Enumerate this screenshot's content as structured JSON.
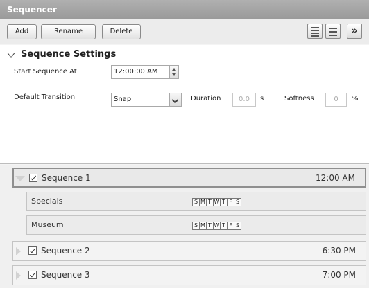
{
  "window": {
    "title": "Sequencer"
  },
  "toolbar": {
    "add_label": "Add",
    "rename_label": "Rename",
    "delete_label": "Delete",
    "icons": [
      "list-view-icon",
      "detail-view-icon",
      "expand-panel-icon"
    ],
    "more_glyph": "»"
  },
  "settings": {
    "title": "Sequence Settings",
    "start_label": "Start Sequence At",
    "start_value": "12:00:00 AM",
    "transition_label": "Default Transition",
    "transition_value": "Snap",
    "duration_label": "Duration",
    "duration_value": "0.0",
    "duration_unit": "s",
    "softness_label": "Softness",
    "softness_value": "0",
    "softness_unit": "%"
  },
  "sequences": [
    {
      "name": "Sequence 1",
      "time": "12:00 AM",
      "expanded": true,
      "children": [
        {
          "name": "Specials",
          "days": [
            "S",
            "M",
            "T",
            "W",
            "T",
            "F",
            "S"
          ]
        },
        {
          "name": "Museum",
          "days": [
            "S",
            "M",
            "T",
            "W",
            "T",
            "F",
            "S"
          ]
        }
      ]
    },
    {
      "name": "Sequence 2",
      "time": "6:30 PM",
      "expanded": false
    },
    {
      "name": "Sequence 3",
      "time": "7:00 PM",
      "expanded": false
    }
  ]
}
